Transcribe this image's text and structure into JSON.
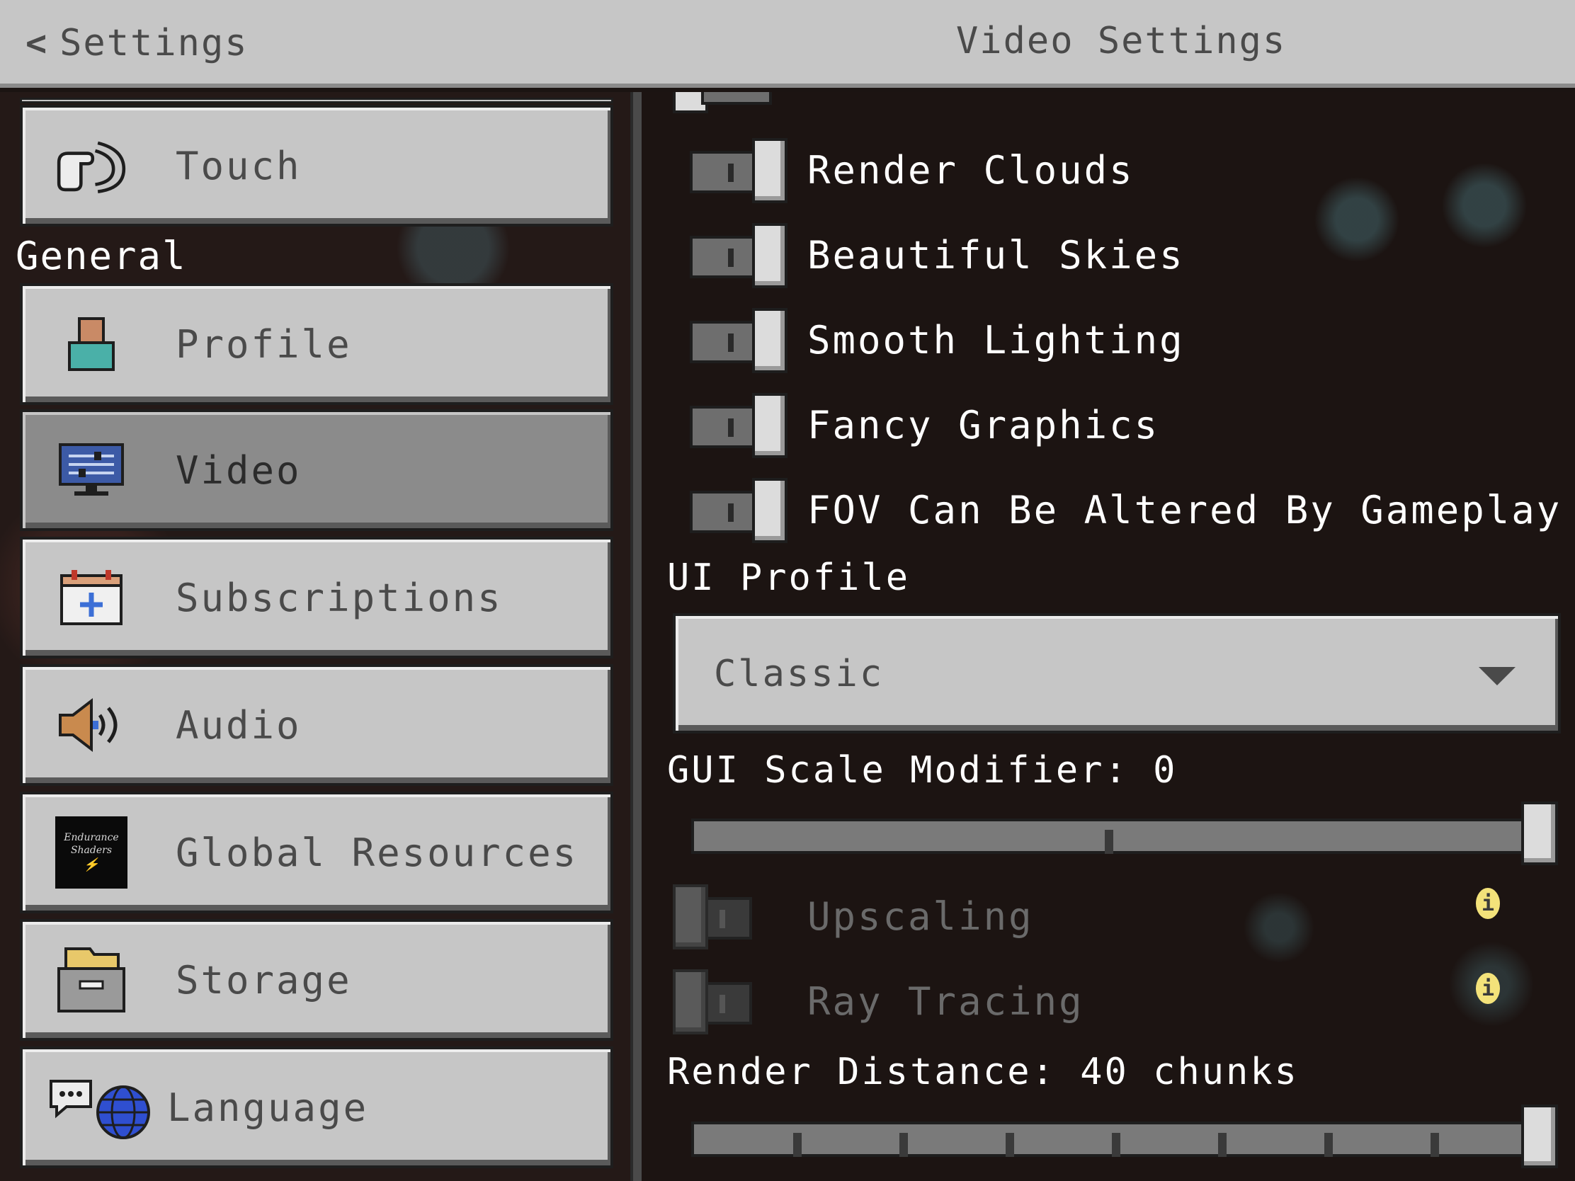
{
  "header": {
    "back_label": "Settings",
    "title": "Video Settings"
  },
  "sidebar": {
    "section_general": "General",
    "items": [
      {
        "label": "Touch",
        "icon": "touch-hand-icon"
      },
      {
        "label": "Profile",
        "icon": "profile-icon"
      },
      {
        "label": "Video",
        "icon": "monitor-icon",
        "selected": true
      },
      {
        "label": "Subscriptions",
        "icon": "calendar-plus-icon"
      },
      {
        "label": "Audio",
        "icon": "speaker-icon"
      },
      {
        "label": "Global Resources",
        "icon": "resource-pack-icon",
        "pack_text": "Endurance Shaders"
      },
      {
        "label": "Storage",
        "icon": "storage-box-icon"
      },
      {
        "label": "Language",
        "icon": "language-globe-icon"
      }
    ]
  },
  "video": {
    "toggles": [
      {
        "label": "Render Clouds",
        "on": true
      },
      {
        "label": "Beautiful Skies",
        "on": true
      },
      {
        "label": "Smooth Lighting",
        "on": true
      },
      {
        "label": "Fancy Graphics",
        "on": true
      },
      {
        "label": "FOV Can Be Altered By Gameplay",
        "on": true
      }
    ],
    "ui_profile_label": "UI Profile",
    "ui_profile_value": "Classic",
    "gui_scale_label": "GUI Scale Modifier: 0",
    "gui_scale_value": 0,
    "disabled_toggles": [
      {
        "label": "Upscaling",
        "on": false
      },
      {
        "label": "Ray Tracing",
        "on": false
      }
    ],
    "render_distance_label": "Render Distance: 40 chunks",
    "render_distance_chunks": 40
  },
  "colors": {
    "header_bg": "#c6c6c6",
    "button_bg": "#c6c6c6",
    "button_selected_bg": "#8b8b8b",
    "info_icon": "#f3e27a"
  }
}
